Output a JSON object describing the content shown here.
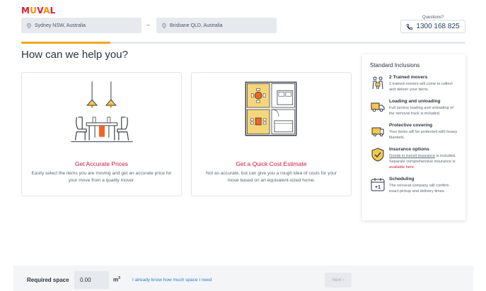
{
  "brand": {
    "logo_letters": [
      "M",
      "U",
      "V",
      "A",
      "L"
    ],
    "logo_text": "MUVAL"
  },
  "route": {
    "from": "Sydney NSW, Australia",
    "to": "Brisbane QLD, Australia",
    "arrow": "→"
  },
  "contact": {
    "label": "Questions?",
    "phone": "1300 168 825"
  },
  "progress": {
    "percent": 20
  },
  "main": {
    "title": "How can we help you?",
    "cards": [
      {
        "title": "Get Accurate Prices",
        "description": "Easily select the items you are moving and get an accurate price for your move from a quality mover."
      },
      {
        "title": "Get a Quick Cost Estimate",
        "description": "Not as accurate, but can give you a rough idea of costs for your move based on an equivalent-sized home."
      }
    ]
  },
  "inclusions": {
    "heading": "Standard Inclusions",
    "items": [
      {
        "title": "2 Trained movers",
        "desc": "2 trained movers will come to collect and deliver your items."
      },
      {
        "title": "Loading and unloading",
        "desc": "Full service loading and unloading of the removal truck is included."
      },
      {
        "title": "Protective covering",
        "desc": "Your items will be protected with heavy blankets."
      },
      {
        "title": "Insurance options",
        "desc_link": "Goods in transit insurance",
        "desc_mid": " is included. Separate comprehensive insurance is ",
        "desc_red": "available here."
      },
      {
        "title": "Scheduling",
        "desc": "The removal company will confirm exact pickup and delivery times.",
        "calendar_label": "+1"
      }
    ]
  },
  "footer": {
    "required_label": "Required space",
    "value": "0.00",
    "unit": "m",
    "unit_sup": "3",
    "link": "I already know how much space I need",
    "next": "Next ›"
  },
  "colors": {
    "accent": "#f5a623",
    "brand_red": "#e5173f",
    "link": "#2a7bd1"
  }
}
